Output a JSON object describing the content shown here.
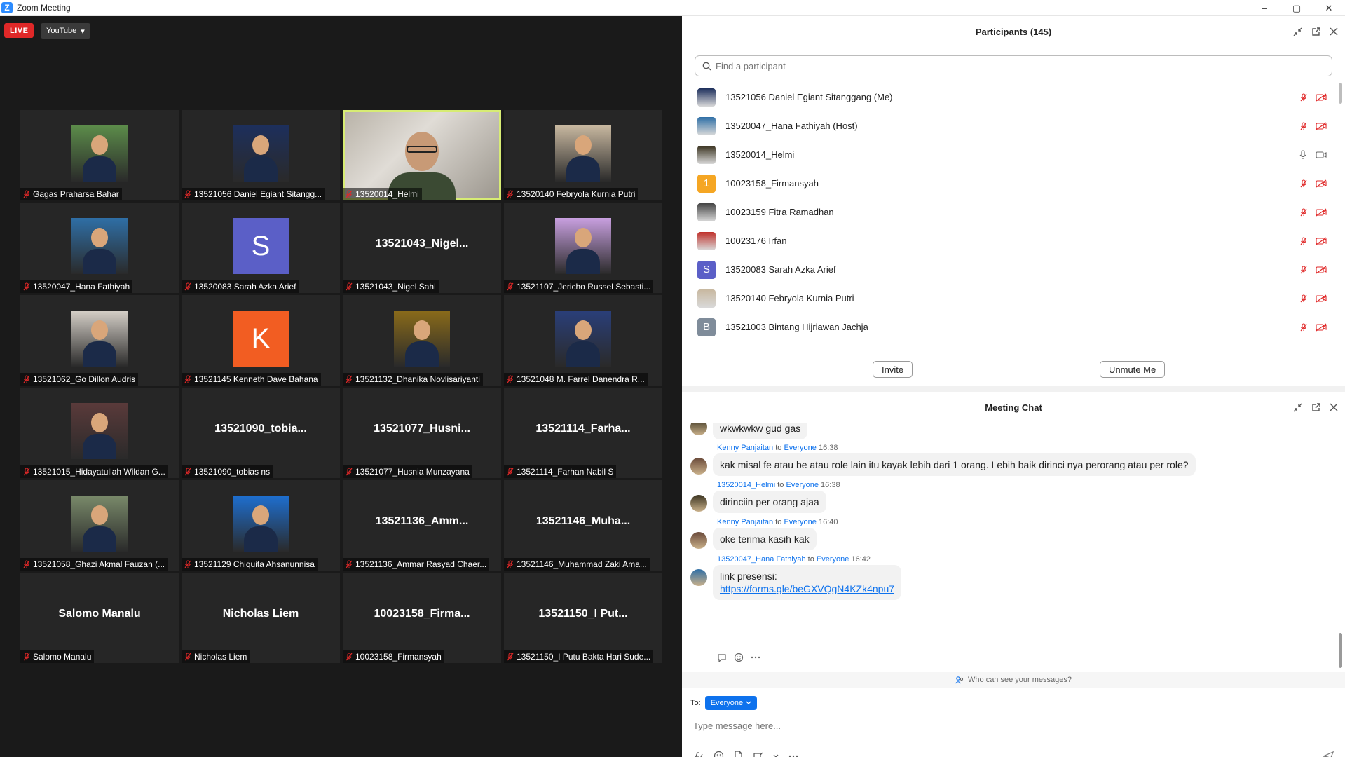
{
  "window": {
    "title": "Zoom Meeting",
    "min": "–",
    "max": "▢",
    "close": "✕"
  },
  "stream": {
    "live_label": "LIVE",
    "platform_label": "YouTube",
    "platform_caret": "▾"
  },
  "tiles": [
    {
      "label": "Gagas Praharsa Bahar",
      "kind": "photo",
      "bg": "#5c8c4a"
    },
    {
      "label": "13521056 Daniel Egiant Sitangg...",
      "kind": "photo",
      "bg": "#1d2f5c"
    },
    {
      "label": "13520014_Helmi",
      "kind": "video",
      "bg": "#8a857c"
    },
    {
      "label": "13520140 Febryola Kurnia Putri",
      "kind": "photo",
      "bg": "#c8b8a0"
    },
    {
      "label": "13520047_Hana Fathiyah",
      "kind": "photo",
      "bg": "#2f6fa6"
    },
    {
      "label": "13520083 Sarah Azka Arief",
      "kind": "letter",
      "letter": "S",
      "bg": "#5b5fc7"
    },
    {
      "label": "13521043_Nigel Sahl",
      "kind": "name",
      "bigname": "13521043_Nigel..."
    },
    {
      "label": "13521107_Jericho Russel Sebasti...",
      "kind": "photo",
      "bg": "#c9a0e0"
    },
    {
      "label": "13521062_Go Dillon Audris",
      "kind": "photo",
      "bg": "#d6d0c8"
    },
    {
      "label": "13521145 Kenneth Dave Bahana",
      "kind": "letter",
      "letter": "K",
      "bg": "#f25d22"
    },
    {
      "label": "13521132_Dhanika Novlisariyanti",
      "kind": "photo",
      "bg": "#8a6b1a"
    },
    {
      "label": "13521048 M. Farrel Danendra R...",
      "kind": "photo",
      "bg": "#2a3f7a"
    },
    {
      "label": "13521015_Hidayatullah Wildan G...",
      "kind": "photo",
      "bg": "#5a3a3a"
    },
    {
      "label": "13521090_tobias ns",
      "kind": "name",
      "bigname": "13521090_tobia..."
    },
    {
      "label": "13521077_Husnia Munzayana",
      "kind": "name",
      "bigname": "13521077_Husni..."
    },
    {
      "label": "13521114_Farhan Nabil S",
      "kind": "name",
      "bigname": "13521114_Farha..."
    },
    {
      "label": "13521058_Ghazi Akmal Fauzan (...",
      "kind": "photo",
      "bg": "#7a8a6a"
    },
    {
      "label": "13521129 Chiquita Ahsanunnisa",
      "kind": "photo",
      "bg": "#1e6fd0"
    },
    {
      "label": "13521136_Ammar Rasyad Chaer...",
      "kind": "name",
      "bigname": "13521136_Amm..."
    },
    {
      "label": "13521146_Muhammad Zaki Ama...",
      "kind": "name",
      "bigname": "13521146_Muha..."
    },
    {
      "label": "Salomo Manalu",
      "kind": "name",
      "bigname": "Salomo Manalu"
    },
    {
      "label": "Nicholas Liem",
      "kind": "name",
      "bigname": "Nicholas Liem"
    },
    {
      "label": "10023158_Firmansyah",
      "kind": "name",
      "bigname": "10023158_Firma..."
    },
    {
      "label": "13521150_I Putu Bakta Hari Sude...",
      "kind": "name",
      "bigname": "13521150_I Put..."
    }
  ],
  "participants": {
    "title": "Participants (145)",
    "search_placeholder": "Find a participant",
    "list": [
      {
        "name": "13521056 Daniel Egiant Sitanggang (Me)",
        "avatar": "photo",
        "bg": "#1d2f5c",
        "muted": true
      },
      {
        "name": "13520047_Hana Fathiyah (Host)",
        "avatar": "photo",
        "bg": "#2f6fa6",
        "muted": true
      },
      {
        "name": "13520014_Helmi",
        "avatar": "photo",
        "bg": "#3a3320",
        "muted": false
      },
      {
        "name": "10023158_Firmansyah",
        "avatar": "letter",
        "letter": "1",
        "bg": "#f5a623",
        "muted": true
      },
      {
        "name": "10023159 Fitra Ramadhan",
        "avatar": "photo",
        "bg": "#444444",
        "muted": true
      },
      {
        "name": "10023176 Irfan",
        "avatar": "photo",
        "bg": "#c0302a",
        "muted": true
      },
      {
        "name": "13520083 Sarah Azka Arief",
        "avatar": "letter",
        "letter": "S",
        "bg": "#5b5fc7",
        "muted": true
      },
      {
        "name": "13520140 Febryola Kurnia Putri",
        "avatar": "photo",
        "bg": "#c8b8a0",
        "muted": true
      },
      {
        "name": "13521003 Bintang Hijriawan Jachja",
        "avatar": "letter",
        "letter": "B",
        "bg": "#7f8c9a",
        "muted": true
      }
    ],
    "invite_label": "Invite",
    "unmute_label": "Unmute Me"
  },
  "chat": {
    "title": "Meeting Chat",
    "messages": [
      {
        "sender": "",
        "to_word": "",
        "recipient": "",
        "time": "",
        "text": "wkwkwkw gud gas",
        "avatar_bg": "#3a3320"
      },
      {
        "sender": "Kenny Panjaitan",
        "to_word": "to",
        "recipient": "Everyone",
        "time": "16:38",
        "text": "kak misal fe atau be atau role lain itu kayak lebih dari 1 orang. Lebih baik dirinci nya perorang atau per role?",
        "avatar_bg": "#6a4a3a"
      },
      {
        "sender": "13520014_Helmi",
        "to_word": "to",
        "recipient": "Everyone",
        "time": "16:38",
        "text": "dirinciin per orang ajaa",
        "avatar_bg": "#3a3320"
      },
      {
        "sender": "Kenny Panjaitan",
        "to_word": "to",
        "recipient": "Everyone",
        "time": "16:40",
        "text": "oke terima kasih kak",
        "avatar_bg": "#6a4a3a"
      },
      {
        "sender": "13520047_Hana Fathiyah",
        "to_word": "to",
        "recipient": "Everyone",
        "time": "16:42",
        "text": "link presensi:",
        "link": "https://forms.gle/beGXVQgN4KZk4npu7",
        "avatar_bg": "#2f6fa6"
      }
    ],
    "who_can_see": "Who can see your messages?",
    "to_label": "To:",
    "to_value": "Everyone",
    "input_placeholder": "Type message here..."
  },
  "colors": {
    "accent": "#0e72ed",
    "live": "#e02828",
    "active_speaker": "#d7ec74",
    "muted": "#e02828"
  }
}
